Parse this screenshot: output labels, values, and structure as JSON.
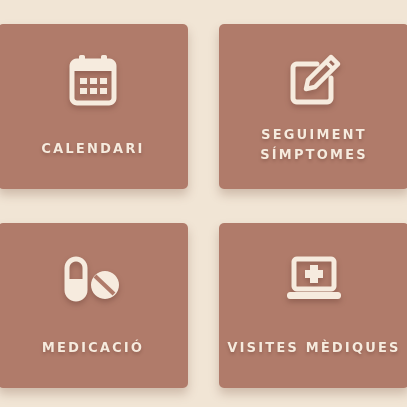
{
  "colors": {
    "background": "#f1e5d5",
    "tile": "#b07b6a",
    "foreground": "#f6ebde"
  },
  "tiles": [
    {
      "label": "CALENDARI",
      "icon": "calendar-icon"
    },
    {
      "label": "SEGUIMENT\nSÍMPTOMES",
      "icon": "edit-note-icon"
    },
    {
      "label": "MEDICACIÓ",
      "icon": "pills-icon"
    },
    {
      "label": "VISITES MÈDIQUES",
      "icon": "laptop-medical-icon"
    }
  ]
}
